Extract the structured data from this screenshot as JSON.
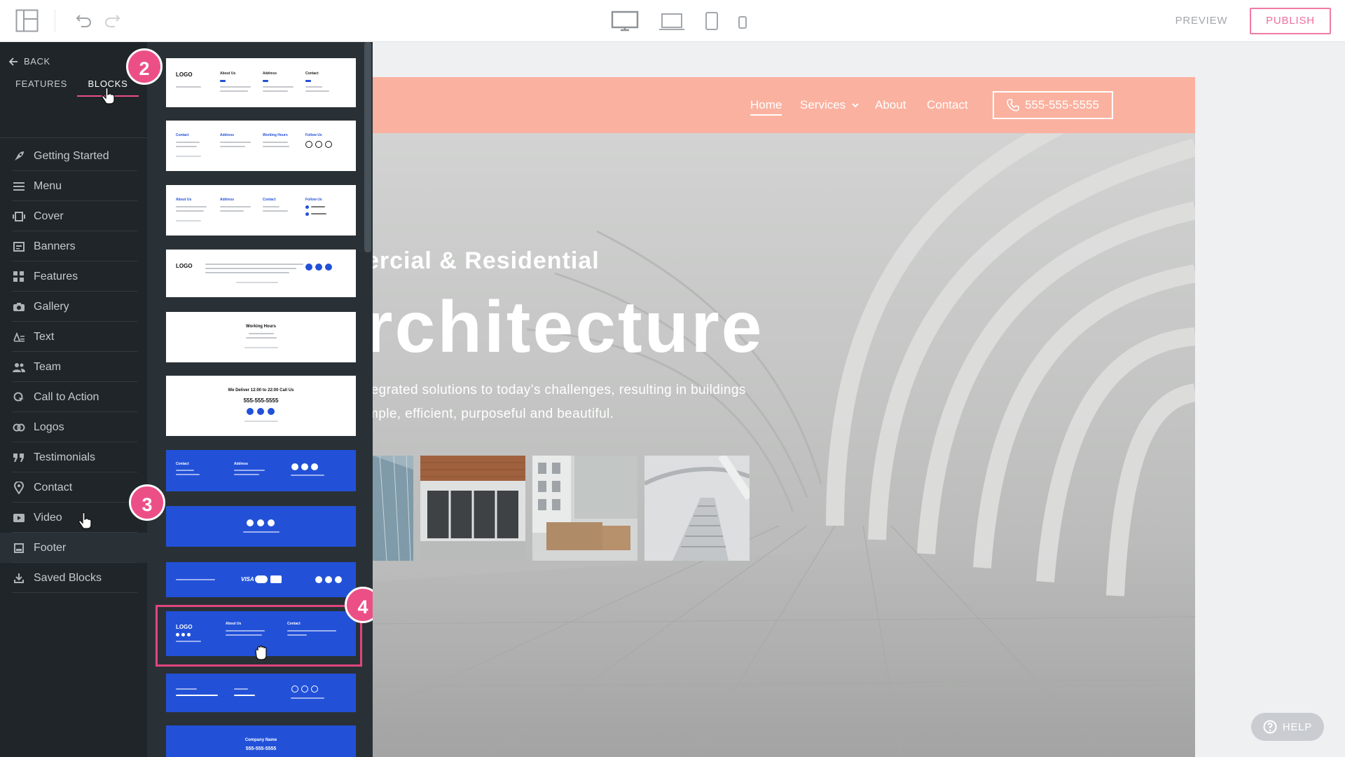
{
  "toolbar": {
    "preview_label": "PREVIEW",
    "publish_label": "PUBLISH"
  },
  "sidebar": {
    "back_label": "BACK",
    "tabs": [
      "FEATURES",
      "BLOCKS"
    ],
    "active_tab": "BLOCKS",
    "items": [
      {
        "label": "Getting Started",
        "icon": "rocket-icon"
      },
      {
        "label": "Menu",
        "icon": "menu-icon"
      },
      {
        "label": "Cover",
        "icon": "cover-icon"
      },
      {
        "label": "Banners",
        "icon": "banner-icon"
      },
      {
        "label": "Features",
        "icon": "grid-icon"
      },
      {
        "label": "Gallery",
        "icon": "camera-icon"
      },
      {
        "label": "Text",
        "icon": "text-icon"
      },
      {
        "label": "Team",
        "icon": "team-icon"
      },
      {
        "label": "Call to Action",
        "icon": "cta-icon"
      },
      {
        "label": "Logos",
        "icon": "logos-icon"
      },
      {
        "label": "Testimonials",
        "icon": "quote-icon"
      },
      {
        "label": "Contact",
        "icon": "location-pin-icon"
      },
      {
        "label": "Video",
        "icon": "video-icon"
      },
      {
        "label": "Footer",
        "icon": "footer-icon"
      },
      {
        "label": "Saved Blocks",
        "icon": "download-icon"
      }
    ],
    "active_item": "Footer"
  },
  "blocks_panel": {
    "thumb1": {
      "logo": "LOGO",
      "col1": "About Us",
      "col2": "Address",
      "col3": "Contact"
    },
    "thumb2": {
      "col1": "Contact",
      "col2": "Address",
      "col3": "Working Hours",
      "col4": "Follow Us"
    },
    "thumb3": {
      "col1": "About Us",
      "col2": "Address",
      "col3": "Contact",
      "col4": "Follow Us"
    },
    "thumb4": {
      "logo": "LOGO"
    },
    "thumb5": {
      "title": "Working Hours"
    },
    "thumb6": {
      "title": "We Deliver 12:00 to 22:00 Call Us",
      "phone": "555-555-5555"
    },
    "thumb7": {
      "col1": "Contact",
      "col2": "Address"
    },
    "thumb9": {
      "payments": "VISA"
    },
    "thumb10": {
      "logo": "LOGO",
      "col1": "About Us",
      "col2": "Contact"
    },
    "thumb12": {
      "title": "Company Name",
      "phone": "555-555-5555"
    }
  },
  "annotations": {
    "step2": "2",
    "step3": "3",
    "step4": "4"
  },
  "site": {
    "nav": [
      {
        "label": "Home",
        "active": true
      },
      {
        "label": "Services",
        "dropdown": true
      },
      {
        "label": "About"
      },
      {
        "label": "Contact"
      }
    ],
    "phone": "555-555-5555",
    "hero_sub": "ercial & Residential",
    "hero_title": "rchitecture",
    "hero_text1": "tegrated solutions to today’s challenges, resulting in buildings",
    "hero_text2": "mple, efficient, purposeful and beautiful.",
    "accent": "#fbb19f"
  },
  "help_label": "HELP",
  "colors": {
    "sidebar_bg": "#1f2529",
    "panel_bg": "#2a3136",
    "accent_pink": "#ec4f86",
    "block_blue": "#2251d8"
  }
}
